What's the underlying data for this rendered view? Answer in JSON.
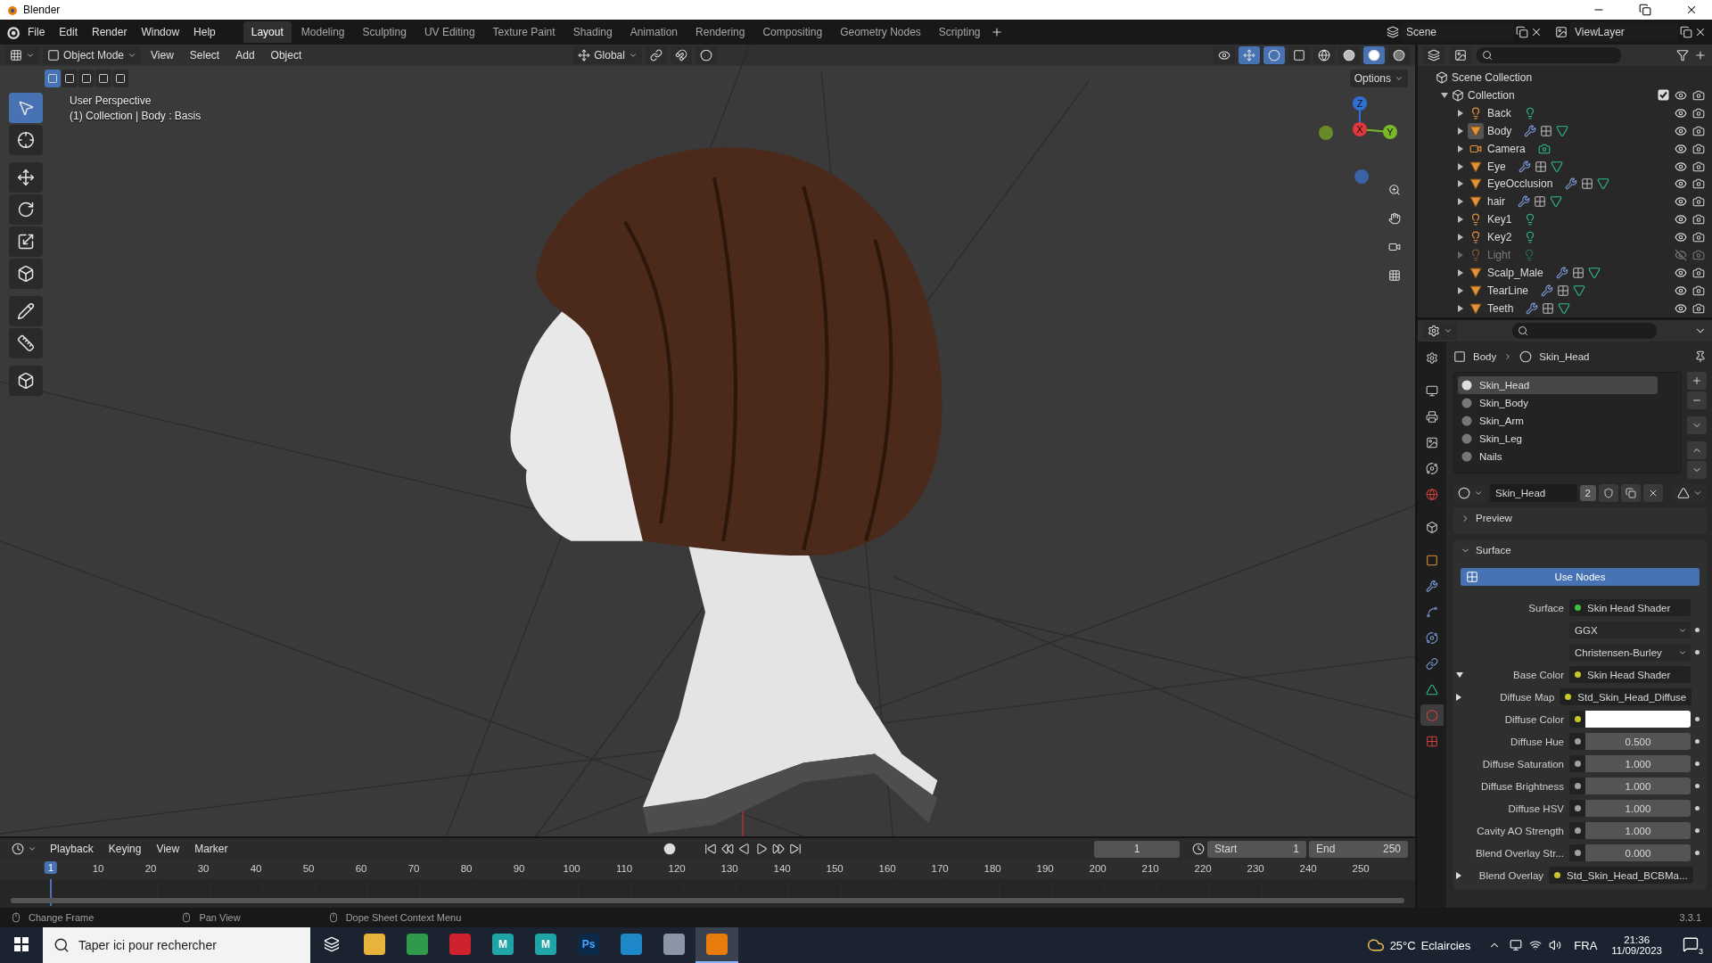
{
  "window": {
    "title": "Blender"
  },
  "menus": [
    "File",
    "Edit",
    "Render",
    "Window",
    "Help"
  ],
  "workspaces": [
    {
      "label": "Layout",
      "selected": true
    },
    {
      "label": "Modeling",
      "selected": false
    },
    {
      "label": "Sculpting",
      "selected": false
    },
    {
      "label": "UV Editing",
      "selected": false
    },
    {
      "label": "Texture Paint",
      "selected": false
    },
    {
      "label": "Shading",
      "selected": false
    },
    {
      "label": "Animation",
      "selected": false
    },
    {
      "label": "Rendering",
      "selected": false
    },
    {
      "label": "Compositing",
      "selected": false
    },
    {
      "label": "Geometry Nodes",
      "selected": false
    },
    {
      "label": "Scripting",
      "selected": false
    }
  ],
  "scene": "Scene",
  "view_layer": "ViewLayer",
  "viewport": {
    "mode": "Object Mode",
    "menus": [
      "View",
      "Select",
      "Add",
      "Object"
    ],
    "orientation": "Global",
    "options": "Options",
    "select_modes": [
      {
        "selected": true
      },
      {
        "selected": false
      },
      {
        "selected": false
      },
      {
        "selected": false
      },
      {
        "selected": false
      }
    ],
    "shading": [
      {
        "kind": "wireframe",
        "selected": false
      },
      {
        "kind": "solid",
        "selected": false
      },
      {
        "kind": "material",
        "selected": true
      },
      {
        "kind": "rendered",
        "selected": false
      }
    ],
    "tools": [
      {
        "kind": "select",
        "selected": true
      },
      {
        "kind": "cursor",
        "selected": false
      },
      {
        "kind": "move",
        "selected": false
      },
      {
        "kind": "rotate",
        "selected": false
      },
      {
        "kind": "scale",
        "selected": false
      },
      {
        "kind": "transform",
        "selected": false
      },
      {
        "kind": "annotate",
        "selected": false
      },
      {
        "kind": "measure",
        "selected": false
      },
      {
        "kind": "add_cube",
        "selected": false
      }
    ],
    "overlay": [
      "User Perspective",
      "(1) Collection | Body : Basis"
    ],
    "gizmo_axes": [
      "Z",
      "X",
      "Y"
    ]
  },
  "outliner": {
    "root": "Scene Collection",
    "collection": {
      "name": "Collection",
      "expanded": true,
      "checked": true
    },
    "objects": [
      {
        "name": "Back",
        "kind": "light",
        "active": false,
        "hidden": false
      },
      {
        "name": "Body",
        "kind": "mesh",
        "active": true,
        "hidden": false
      },
      {
        "name": "Camera",
        "kind": "camera",
        "active": false,
        "hidden": false
      },
      {
        "name": "Eye",
        "kind": "mesh",
        "active": false,
        "hidden": false
      },
      {
        "name": "EyeOcclusion",
        "kind": "mesh",
        "active": false,
        "hidden": false
      },
      {
        "name": "hair",
        "kind": "mesh",
        "active": false,
        "hidden": false
      },
      {
        "name": "Key1",
        "kind": "light",
        "active": false,
        "hidden": false
      },
      {
        "name": "Key2",
        "kind": "light",
        "active": false,
        "hidden": false
      },
      {
        "name": "Light",
        "kind": "light",
        "active": false,
        "hidden": true
      },
      {
        "name": "Scalp_Male",
        "kind": "mesh",
        "active": false,
        "hidden": false
      },
      {
        "name": "TearLine",
        "kind": "mesh",
        "active": false,
        "hidden": false
      },
      {
        "name": "Teeth",
        "kind": "mesh",
        "active": false,
        "hidden": false
      }
    ]
  },
  "properties": {
    "tabs": [
      {
        "kind": "tool",
        "selected": false
      },
      {
        "kind": "render",
        "selected": false
      },
      {
        "kind": "output",
        "selected": false
      },
      {
        "kind": "view_layer",
        "selected": false
      },
      {
        "kind": "scene",
        "selected": false
      },
      {
        "kind": "world",
        "selected": false
      },
      {
        "kind": "collection",
        "selected": false
      },
      {
        "kind": "object",
        "selected": false
      },
      {
        "kind": "modifiers",
        "selected": false
      },
      {
        "kind": "particles",
        "selected": false
      },
      {
        "kind": "physics",
        "selected": false
      },
      {
        "kind": "constraints",
        "selected": false
      },
      {
        "kind": "data",
        "selected": false
      },
      {
        "kind": "material",
        "selected": true
      },
      {
        "kind": "texture",
        "selected": false
      }
    ],
    "breadcrumb": [
      "Body",
      "Skin_Head"
    ],
    "slots": [
      {
        "name": "Skin_Head",
        "selected": true
      },
      {
        "name": "Skin_Body",
        "selected": false
      },
      {
        "name": "Skin_Arm",
        "selected": false
      },
      {
        "name": "Skin_Leg",
        "selected": false
      },
      {
        "name": "Nails",
        "selected": false
      }
    ],
    "material": "Skin_Head",
    "users": "2",
    "panels": [
      {
        "title": "Preview",
        "expanded": false
      },
      {
        "title": "Surface",
        "expanded": true
      }
    ],
    "use_nodes": "Use Nodes",
    "fields": [
      {
        "kind": "link",
        "label": "Surface",
        "value": "Skin Head Shader",
        "color": "#3fbf3f"
      },
      {
        "kind": "dropdown",
        "value": "GGX"
      },
      {
        "kind": "dropdown",
        "value": "Christensen-Burley"
      },
      {
        "kind": "link",
        "label": "Base Color",
        "value": "Skin Head Shader",
        "color": "#c7c729",
        "expanded": true
      },
      {
        "kind": "link",
        "label": "Diffuse Map",
        "value": "Std_Skin_Head_Diffuse",
        "color": "#c7c729",
        "expanded": false
      },
      {
        "kind": "swatch",
        "label": "Diffuse Color",
        "color": "#c7c729"
      },
      {
        "kind": "number",
        "label": "Diffuse Hue",
        "value": "0.500",
        "color": "#a1a1a1"
      },
      {
        "kind": "number",
        "label": "Diffuse Saturation",
        "value": "1.000",
        "color": "#a1a1a1"
      },
      {
        "kind": "number",
        "label": "Diffuse Brightness",
        "value": "1.000",
        "color": "#a1a1a1"
      },
      {
        "kind": "number",
        "label": "Diffuse HSV",
        "value": "1.000",
        "color": "#a1a1a1"
      },
      {
        "kind": "number",
        "label": "Cavity AO Strength",
        "value": "1.000",
        "color": "#a1a1a1"
      },
      {
        "kind": "number",
        "label": "Blend Overlay Str...",
        "value": "0.000",
        "color": "#a1a1a1"
      },
      {
        "kind": "link",
        "label": "Blend Overlay",
        "value": "Std_Skin_Head_BCBMa...",
        "color": "#c7c729",
        "expanded": false
      }
    ]
  },
  "timeline": {
    "menus": [
      "Playback",
      "Keying",
      "View",
      "Marker"
    ],
    "current_frame": "1",
    "start_label": "Start",
    "start": "1",
    "end_label": "End",
    "end": "250",
    "playhead": "1",
    "ticks": [
      "10",
      "20",
      "30",
      "40",
      "50",
      "60",
      "70",
      "80",
      "90",
      "100",
      "110",
      "120",
      "130",
      "140",
      "150",
      "160",
      "170",
      "180",
      "190",
      "200",
      "210",
      "220",
      "230",
      "240",
      "250"
    ]
  },
  "status_bar": {
    "hints": [
      "Change Frame",
      "Pan View",
      "Dope Sheet Context Menu"
    ],
    "version": "3.3.1"
  },
  "taskbar": {
    "search_placeholder": "Taper ici pour rechercher",
    "apps": [
      {
        "kind": "files",
        "selected": false
      },
      {
        "kind": "chrome",
        "selected": false
      },
      {
        "kind": "opera",
        "selected": false
      },
      {
        "kind": "maya",
        "label": "M",
        "selected": false
      },
      {
        "kind": "maya",
        "label": "M",
        "selected": false
      },
      {
        "kind": "photoshop",
        "label": "Ps",
        "selected": false
      },
      {
        "kind": "edge",
        "selected": false
      },
      {
        "kind": "window",
        "selected": false
      },
      {
        "kind": "blender",
        "selected": true
      }
    ],
    "temperature": "25°C",
    "weather": "Eclaircies",
    "language": "FRA",
    "time": "21:36",
    "date": "11/09/2023",
    "notifications": "3"
  }
}
